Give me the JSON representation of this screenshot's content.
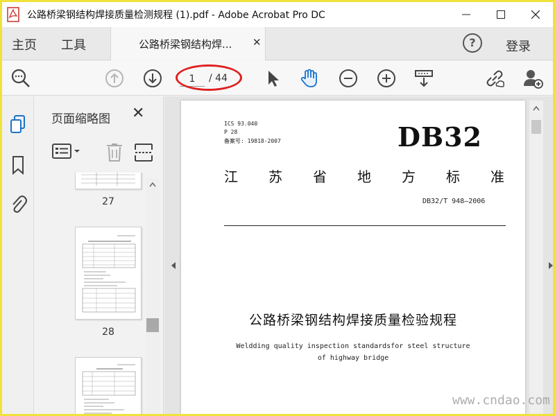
{
  "window": {
    "title": "公路桥梁钢结构焊接质量检测规程 (1).pdf - Adobe Acrobat Pro DC"
  },
  "nav": {
    "home": "主页",
    "tools": "工具",
    "doc_tab": "公路桥梁钢结构焊...",
    "login": "登录",
    "help": "?"
  },
  "toolbar": {
    "page_current": "1",
    "page_total": "/ 44"
  },
  "thumbnails": {
    "title": "页面缩略图",
    "pages": [
      {
        "number": "27"
      },
      {
        "number": "28"
      }
    ]
  },
  "document": {
    "meta": [
      "ICS 93.040",
      "P 28",
      "备案号: 19818-2007"
    ],
    "brand": "DB32",
    "standard_title_chars": [
      "江",
      "苏",
      "省",
      "地",
      "方",
      "标",
      "准"
    ],
    "code": "DB32/T 948—2006",
    "title": "公路桥梁钢结构焊接质量检验规程",
    "subtitle_line1": "Weldding quality inspection standardsfor steel structure",
    "subtitle_line2": "of highway bridge"
  },
  "watermark": "www.cndao.com"
}
